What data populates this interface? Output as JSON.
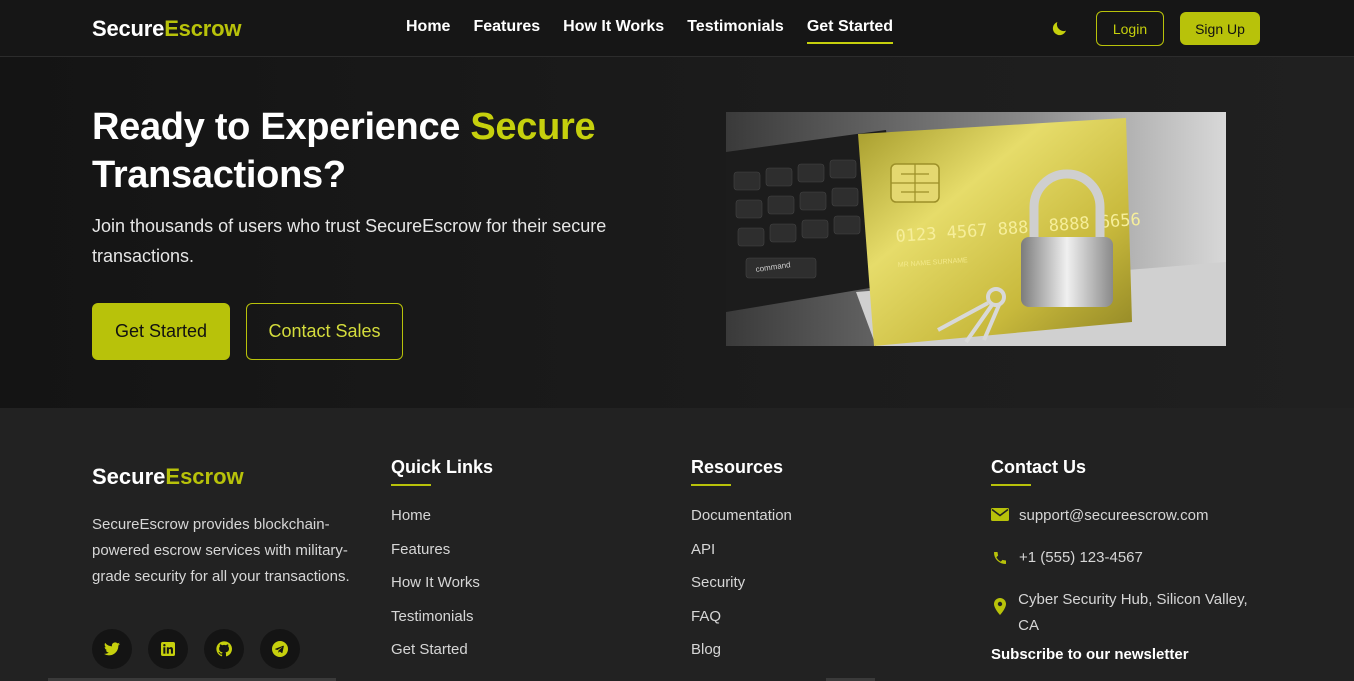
{
  "brand": {
    "part1": "Secure",
    "part2": "Escrow"
  },
  "nav": {
    "links": [
      "Home",
      "Features",
      "How It Works",
      "Testimonials",
      "Get Started"
    ],
    "active_index": 4,
    "login_label": "Login",
    "signup_label": "Sign Up"
  },
  "hero": {
    "title_part1": "Ready to Experience ",
    "title_accent": "Secure",
    "title_part2": "Transactions?",
    "subtitle": "Join thousands of users who trust SecureEscrow for their secure transactions.",
    "primary_button": "Get Started",
    "secondary_button": "Contact Sales",
    "image_card_number": "0123 4567 8888 8888 6656",
    "image_card_name": "MR NAME SURNAME",
    "image_key_label": "command"
  },
  "footer": {
    "description": "SecureEscrow provides blockchain-powered escrow services with military-grade security for all your transactions.",
    "socials": [
      "twitter-icon",
      "linkedin-icon",
      "github-icon",
      "telegram-icon"
    ],
    "quick_links": {
      "title": "Quick Links",
      "items": [
        "Home",
        "Features",
        "How It Works",
        "Testimonials",
        "Get Started"
      ]
    },
    "resources": {
      "title": "Resources",
      "items": [
        "Documentation",
        "API",
        "Security",
        "FAQ",
        "Blog"
      ]
    },
    "contact": {
      "title": "Contact Us",
      "email": "support@secureescrow.com",
      "phone": "+1 (555) 123-4567",
      "address": "Cyber Security Hub, Silicon Valley, CA"
    },
    "newsletter_title": "Subscribe to our newsletter"
  },
  "colors": {
    "accent": "#b8c20a",
    "background": "#1a1a1a",
    "footer_bg": "#222222"
  }
}
